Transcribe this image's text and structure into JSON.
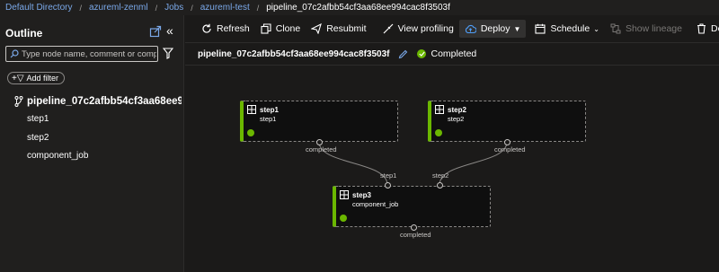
{
  "breadcrumb": {
    "items": [
      "Default Directory",
      "azureml-zenml",
      "Jobs",
      "azureml-test"
    ],
    "current": "pipeline_07c2afbb54cf3aa68ee994cac8f3503f"
  },
  "sidebar": {
    "title": "Outline",
    "search_placeholder": "Type node name, comment or comp...",
    "add_filter_label": "Add filter",
    "root_label": "pipeline_07c2afbb54cf3aa68ee994c...",
    "items": [
      "step1",
      "step2",
      "component_job"
    ]
  },
  "toolbar": {
    "refresh": "Refresh",
    "clone": "Clone",
    "resubmit": "Resubmit",
    "view_profiling": "View profiling",
    "deploy": "Deploy",
    "schedule": "Schedule",
    "show_lineage": "Show lineage",
    "delete": "Delete"
  },
  "titlebar": {
    "name": "pipeline_07c2afbb54cf3aa68ee994cac8f3503f",
    "status": "Completed"
  },
  "graph": {
    "nodes": [
      {
        "title": "step1",
        "subtitle": "step1",
        "output_label": "completed"
      },
      {
        "title": "step2",
        "subtitle": "step2",
        "output_label": "completed"
      },
      {
        "title": "step3",
        "subtitle": "component_job",
        "output_label": "completed"
      }
    ],
    "input_labels": [
      "step1",
      "step2"
    ]
  },
  "colors": {
    "status_green": "#6bb700",
    "link_blue": "#7aa8e8",
    "deploy_icon_blue": "#4f9ef8"
  }
}
